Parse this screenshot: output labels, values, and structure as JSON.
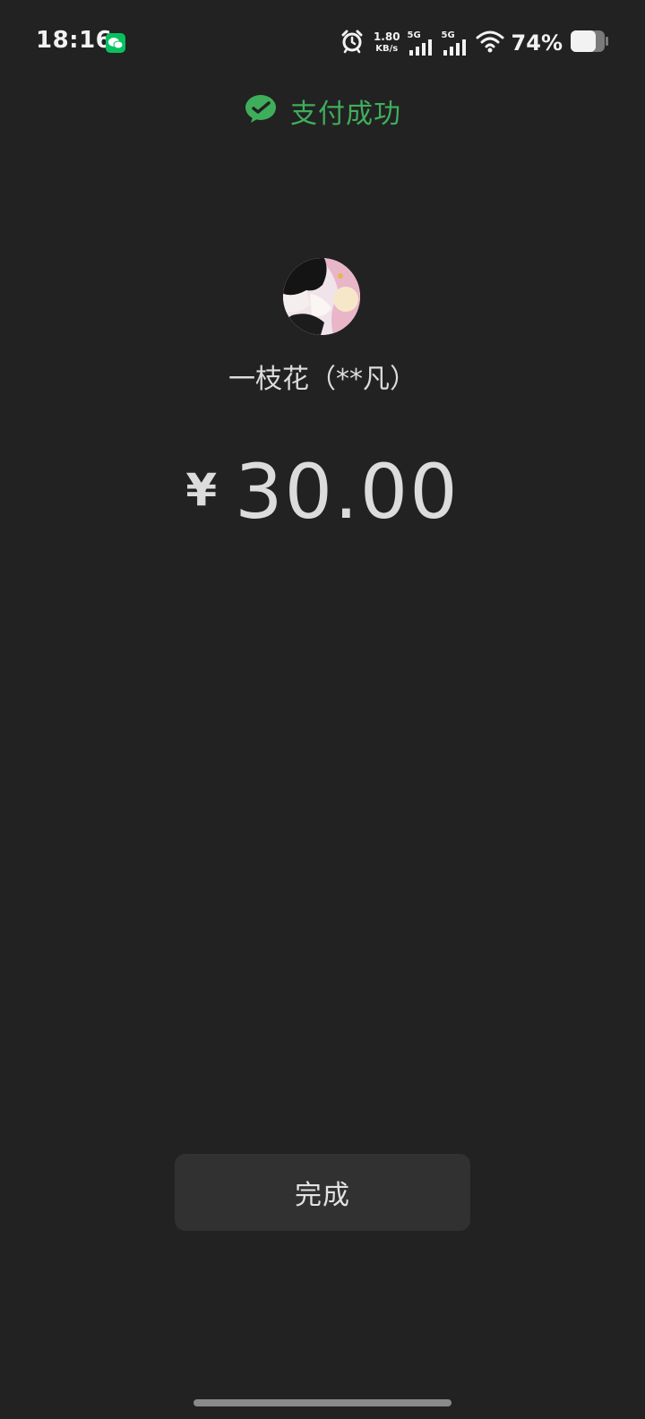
{
  "status_bar": {
    "time": "18:16",
    "net_speed_value": "1.80",
    "net_speed_unit": "KB/s",
    "sim1_label": "5G",
    "sim2_label": "5G",
    "battery_percent": "74%",
    "battery_level": 0.74,
    "notification_icon": "wechat-icon",
    "icons": [
      "alarm-icon",
      "signal-icon",
      "wifi-icon",
      "battery-icon"
    ]
  },
  "header": {
    "icon": "wechat-pay-icon",
    "title": "支付成功"
  },
  "payee": {
    "avatar_icon": "avatar",
    "name": "一枝花（**凡）"
  },
  "payment": {
    "currency_symbol": "¥",
    "amount": "30.00"
  },
  "actions": {
    "done_label": "完成"
  },
  "colors": {
    "background": "#222222",
    "accent_green": "#3fae5c",
    "button_bg": "#313131",
    "text": "#dcdcdc"
  }
}
